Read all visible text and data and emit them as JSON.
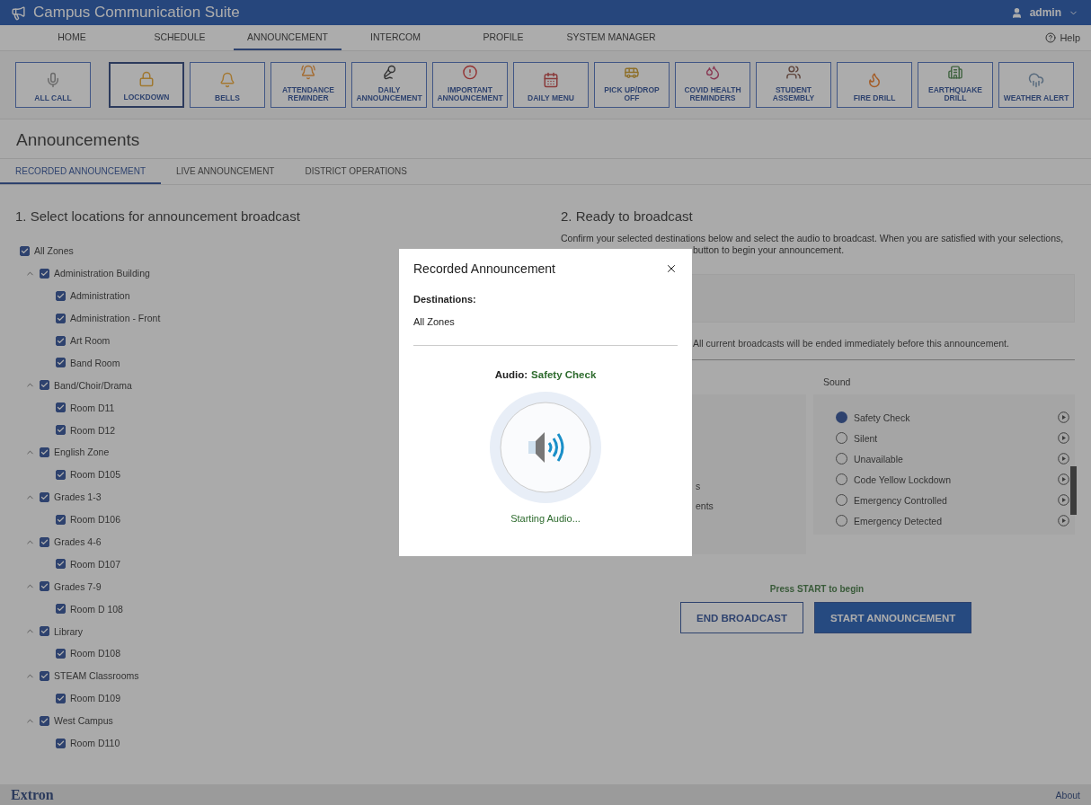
{
  "header": {
    "title": "Campus Communication Suite",
    "user": "admin"
  },
  "nav": {
    "items": [
      {
        "label": "HOME",
        "selected": false
      },
      {
        "label": "SCHEDULE",
        "selected": false
      },
      {
        "label": "ANNOUNCEMENT",
        "selected": true
      },
      {
        "label": "INTERCOM",
        "selected": false
      },
      {
        "label": "PROFILE",
        "selected": false
      },
      {
        "label": "SYSTEM MANAGER",
        "selected": false
      }
    ],
    "help": "Help"
  },
  "quick_actions": [
    {
      "label": "ALL CALL",
      "selected": false
    },
    {
      "label": "LOCKDOWN",
      "selected": true
    },
    {
      "label": "BELLS",
      "selected": false
    },
    {
      "label": "ATTENDANCE REMINDER",
      "selected": false
    },
    {
      "label": "DAILY ANNOUNCEMENT",
      "selected": false
    },
    {
      "label": "IMPORTANT ANNOUNCEMENT",
      "selected": false
    },
    {
      "label": "DAILY MENU",
      "selected": false
    },
    {
      "label": "PICK UP/DROP OFF",
      "selected": false
    },
    {
      "label": "COVID HEALTH REMINDERS",
      "selected": false
    },
    {
      "label": "STUDENT ASSEMBLY",
      "selected": false
    },
    {
      "label": "FIRE DRILL",
      "selected": false
    },
    {
      "label": "EARTHQUAKE DRILL",
      "selected": false
    },
    {
      "label": "WEATHER ALERT",
      "selected": false
    }
  ],
  "page_title": "Announcements",
  "subtabs": [
    {
      "label": "RECORDED ANNOUNCEMENT",
      "selected": true
    },
    {
      "label": "LIVE ANNOUNCEMENT",
      "selected": false
    },
    {
      "label": "DISTRICT OPERATIONS",
      "selected": false
    }
  ],
  "locations": {
    "heading": "1. Select locations for announcement broadcast",
    "tree": [
      {
        "label": "All Zones",
        "checked": true,
        "children": [
          {
            "label": "Administration Building",
            "checked": true,
            "expanded": true,
            "children": [
              {
                "label": "Administration",
                "checked": true
              },
              {
                "label": "Administration - Front",
                "checked": true
              },
              {
                "label": "Art Room",
                "checked": true
              },
              {
                "label": "Band Room",
                "checked": true
              }
            ]
          },
          {
            "label": "Band/Choir/Drama",
            "checked": true,
            "expanded": true,
            "children": [
              {
                "label": "Room D11",
                "checked": true
              },
              {
                "label": "Room D12",
                "checked": true
              }
            ]
          },
          {
            "label": "English Zone",
            "checked": true,
            "expanded": true,
            "children": [
              {
                "label": "Room D105",
                "checked": true
              }
            ]
          },
          {
            "label": "Grades 1-3",
            "checked": true,
            "expanded": true,
            "children": [
              {
                "label": "Room D106",
                "checked": true
              }
            ]
          },
          {
            "label": "Grades 4-6",
            "checked": true,
            "expanded": true,
            "children": [
              {
                "label": "Room D107",
                "checked": true
              }
            ]
          },
          {
            "label": "Grades 7-9",
            "checked": true,
            "expanded": true,
            "children": [
              {
                "label": "Room D 108",
                "checked": true
              }
            ]
          },
          {
            "label": "Library",
            "checked": true,
            "expanded": true,
            "children": [
              {
                "label": "Room D108",
                "checked": true
              }
            ]
          },
          {
            "label": "STEAM Classrooms",
            "checked": true,
            "expanded": true,
            "children": [
              {
                "label": "Room D109",
                "checked": true
              }
            ]
          },
          {
            "label": "West Campus",
            "checked": true,
            "expanded": true,
            "children": [
              {
                "label": "Room D110",
                "checked": true
              }
            ]
          }
        ]
      }
    ]
  },
  "broadcast": {
    "heading": "2. Ready to broadcast",
    "intro_line": "Confirm your selected destinations below and select the audio to broadcast. When you are satisfied with your selections,",
    "intro_tail": "button to begin your announcement.",
    "notice": "All current broadcasts will be ended immediately before this announcement.",
    "list_fragments": [
      "s",
      "ents"
    ],
    "sound_label": "Sound",
    "sounds": [
      {
        "label": "Safety Check",
        "selected": true
      },
      {
        "label": "Silent",
        "selected": false
      },
      {
        "label": "Unavailable",
        "selected": false
      },
      {
        "label": "Code Yellow Lockdown",
        "selected": false
      },
      {
        "label": "Emergency Controlled",
        "selected": false
      },
      {
        "label": "Emergency Detected",
        "selected": false
      }
    ],
    "prompt": "Press START to begin",
    "buttons": [
      {
        "label": "END BROADCAST",
        "kind": "outline"
      },
      {
        "label": "START ANNOUNCEMENT",
        "kind": "primary"
      }
    ]
  },
  "modal": {
    "title": "Recorded Announcement",
    "destinations_label": "Destinations:",
    "destinations": "All Zones",
    "audio_label": "Audio:",
    "audio_name": "Safety Check",
    "status": "Starting Audio..."
  },
  "footer": {
    "brand": "Extron",
    "link": "About"
  }
}
